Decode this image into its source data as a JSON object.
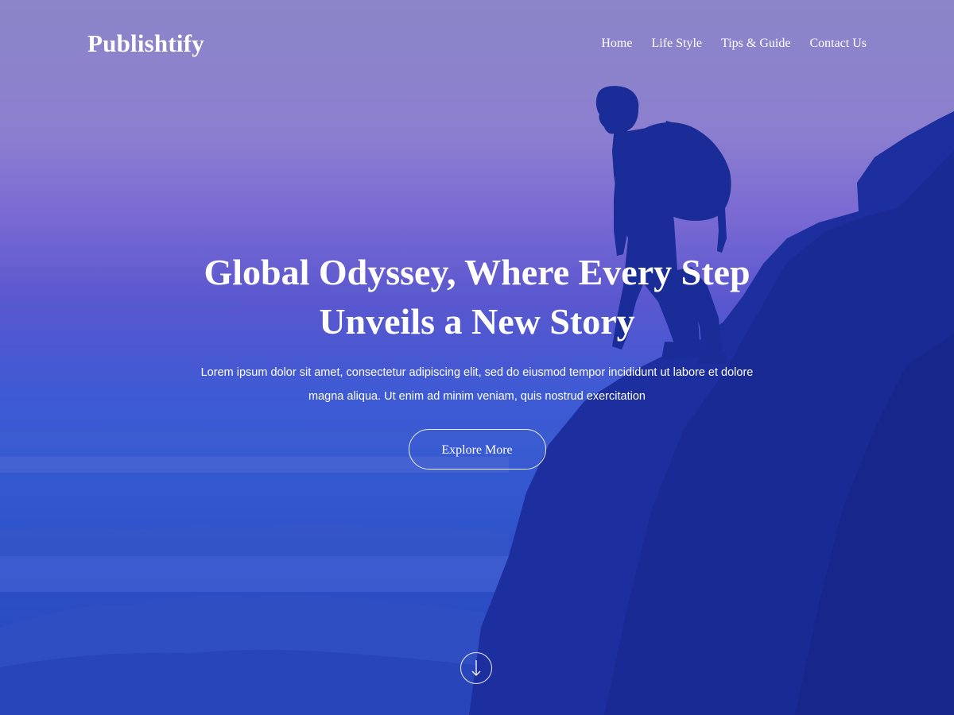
{
  "site": {
    "logo": "Publishtify"
  },
  "nav": {
    "items": [
      {
        "label": "Home"
      },
      {
        "label": "Life Style"
      },
      {
        "label": "Tips & Guide"
      },
      {
        "label": "Contact Us"
      }
    ]
  },
  "hero": {
    "title_line1": "Global Odyssey, Where Every Step",
    "title_line2": "Unveils a New Story",
    "description_line1": "Lorem ipsum dolor sit amet, consectetur adipiscing elit, sed do eiusmod tempor incididunt ut labore et dolore",
    "description_line2": "magna aliqua. Ut enim ad minim veniam, quis nostrud exercitation",
    "cta_label": "Explore More",
    "scroll_icon": "arrow-down-icon",
    "background_image": "hiker-silhouette-on-cliff-over-sea-of-clouds"
  },
  "colors": {
    "text": "#ffffff",
    "overlay_top": "#8a86c8",
    "overlay_bottom": "#2647bb"
  }
}
